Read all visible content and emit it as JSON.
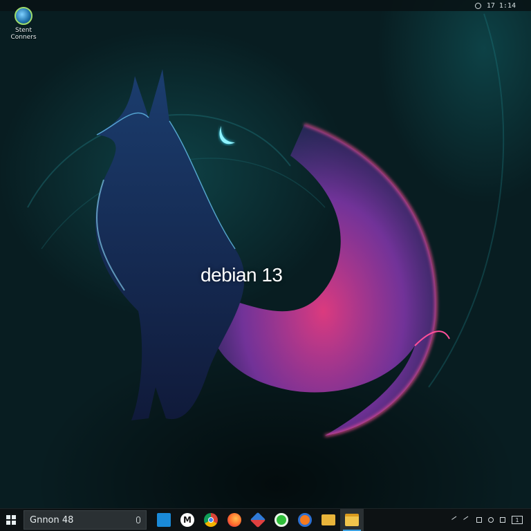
{
  "top_bar": {
    "clock": "17 1:14"
  },
  "desktop": {
    "icons": [
      {
        "label_line1": "Stent",
        "label_line2": "Conners"
      }
    ],
    "wallpaper_title": "debian 13"
  },
  "taskbar": {
    "search_value": "Gnnon 48",
    "apps": [
      {
        "name": "mail-app",
        "icon": "mail-icon"
      },
      {
        "name": "m-app",
        "icon": "m-icon",
        "glyph": "M"
      },
      {
        "name": "chrome",
        "icon": "chrome-icon"
      },
      {
        "name": "firefox",
        "icon": "firefox-icon"
      },
      {
        "name": "tools",
        "icon": "tools-icon"
      },
      {
        "name": "green-app",
        "icon": "green-circle-icon"
      },
      {
        "name": "orange-app",
        "icon": "orange-circle-icon"
      },
      {
        "name": "file-explorer",
        "icon": "folder-icon"
      },
      {
        "name": "files-active",
        "icon": "folder-icon",
        "active": true
      }
    ],
    "tray_notification": "1"
  },
  "colors": {
    "accent_pink": "#ff3f8e",
    "accent_cyan": "#3fe3ff",
    "taskbar": "#0d1214"
  }
}
